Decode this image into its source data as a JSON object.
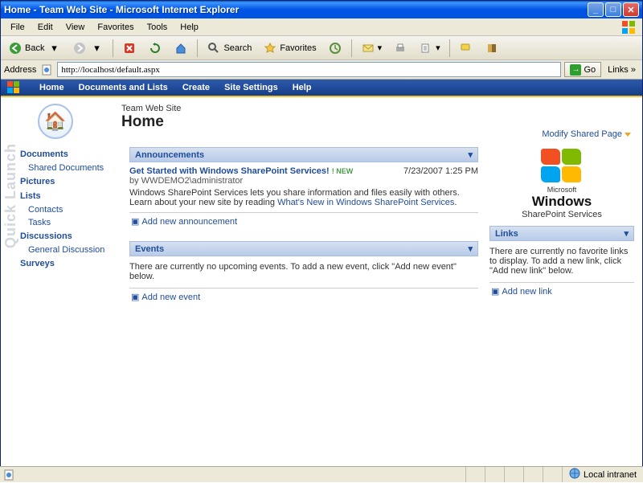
{
  "window": {
    "title": "Home - Team Web Site - Microsoft Internet Explorer"
  },
  "menu": {
    "items": [
      "File",
      "Edit",
      "View",
      "Favorites",
      "Tools",
      "Help"
    ]
  },
  "toolbar": {
    "back": "Back",
    "search": "Search",
    "favorites": "Favorites"
  },
  "address": {
    "label": "Address",
    "value": "http://localhost/default.aspx",
    "go": "Go",
    "links": "Links"
  },
  "nav": {
    "items": [
      "Home",
      "Documents and Lists",
      "Create",
      "Site Settings",
      "Help"
    ]
  },
  "site": {
    "name": "Team Web Site",
    "page": "Home",
    "modify": "Modify Shared Page"
  },
  "quicklaunch": {
    "label": "Quick Launch",
    "groups": [
      {
        "head": "Documents",
        "items": [
          "Shared Documents"
        ]
      },
      {
        "head": "Pictures",
        "items": []
      },
      {
        "head": "Lists",
        "items": [
          "Contacts",
          "Tasks"
        ]
      },
      {
        "head": "Discussions",
        "items": [
          "General Discussion"
        ]
      },
      {
        "head": "Surveys",
        "items": []
      }
    ]
  },
  "webparts": {
    "announcements": {
      "title": "Announcements",
      "item": {
        "title": "Get Started with Windows SharePoint Services!",
        "new": "! NEW",
        "date": "7/23/2007 1:25 PM",
        "by": "by WWDEMO2\\administrator",
        "body_pre": "Windows SharePoint Services lets you share information and files easily with others. Learn about your new site by reading ",
        "body_link": "What's New in Windows SharePoint Services",
        "body_post": "."
      },
      "add": "Add new announcement"
    },
    "events": {
      "title": "Events",
      "empty": "There are currently no upcoming events. To add a new event, click \"Add new event\" below.",
      "add": "Add new event"
    },
    "links": {
      "title": "Links",
      "empty": "There are currently no favorite links to display. To add a new link, click \"Add new link\" below.",
      "add": "Add new link"
    }
  },
  "brand": {
    "ms": "Microsoft",
    "prod": "Windows",
    "sub": "SharePoint Services"
  },
  "status": {
    "zone": "Local intranet"
  }
}
